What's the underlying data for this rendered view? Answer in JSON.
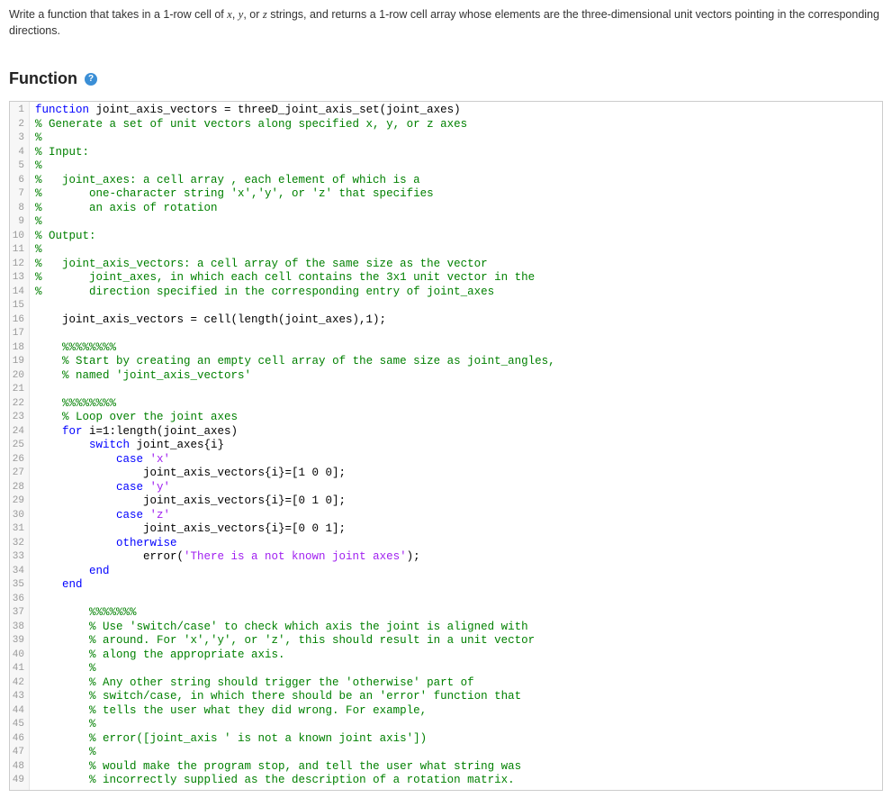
{
  "instruction_parts": {
    "pre": "Write a function that takes in a 1-row cell of ",
    "x": "x",
    "sep1": ", ",
    "y": "y",
    "sep2": ", or ",
    "z": "z",
    "post": " strings, and returns a 1-row cell array whose elements are the three-dimensional unit vectors pointing in the corresponding directions."
  },
  "section_title": "Function",
  "help_glyph": "?",
  "code_lines": [
    [
      [
        "kw",
        "function"
      ],
      [
        "fn",
        " joint_axis_vectors = threeD_joint_axis_set(joint_axes)"
      ]
    ],
    [
      [
        "cm",
        "% Generate a set of unit vectors along specified x, y, or z axes"
      ]
    ],
    [
      [
        "cm",
        "%"
      ]
    ],
    [
      [
        "cm",
        "% Input:"
      ]
    ],
    [
      [
        "cm",
        "%"
      ]
    ],
    [
      [
        "cm",
        "%   joint_axes: a cell array , each element of which is a"
      ]
    ],
    [
      [
        "cm",
        "%       one-character string 'x','y', or 'z' that specifies"
      ]
    ],
    [
      [
        "cm",
        "%       an axis of rotation"
      ]
    ],
    [
      [
        "cm",
        "%"
      ]
    ],
    [
      [
        "cm",
        "% Output:"
      ]
    ],
    [
      [
        "cm",
        "%"
      ]
    ],
    [
      [
        "cm",
        "%   joint_axis_vectors: a cell array of the same size as the vector"
      ]
    ],
    [
      [
        "cm",
        "%       joint_axes, in which each cell contains the 3x1 unit vector in the"
      ]
    ],
    [
      [
        "cm",
        "%       direction specified in the corresponding entry of joint_axes"
      ]
    ],
    [
      [
        "fn",
        ""
      ]
    ],
    [
      [
        "fn",
        "    joint_axis_vectors = cell(length(joint_axes),1);"
      ]
    ],
    [
      [
        "fn",
        ""
      ]
    ],
    [
      [
        "fn",
        "    "
      ],
      [
        "cm",
        "%%%%%%%%"
      ]
    ],
    [
      [
        "fn",
        "    "
      ],
      [
        "cm",
        "% Start by creating an empty cell array of the same size as joint_angles,"
      ]
    ],
    [
      [
        "fn",
        "    "
      ],
      [
        "cm",
        "% named 'joint_axis_vectors'"
      ]
    ],
    [
      [
        "fn",
        ""
      ]
    ],
    [
      [
        "fn",
        "    "
      ],
      [
        "cm",
        "%%%%%%%%"
      ]
    ],
    [
      [
        "fn",
        "    "
      ],
      [
        "cm",
        "% Loop over the joint axes"
      ]
    ],
    [
      [
        "fn",
        "    "
      ],
      [
        "kw",
        "for"
      ],
      [
        "fn",
        " i=1:length(joint_axes)"
      ]
    ],
    [
      [
        "fn",
        "        "
      ],
      [
        "kw",
        "switch"
      ],
      [
        "fn",
        " joint_axes{i}"
      ]
    ],
    [
      [
        "fn",
        "            "
      ],
      [
        "kw",
        "case"
      ],
      [
        "fn",
        " "
      ],
      [
        "str",
        "'x'"
      ]
    ],
    [
      [
        "fn",
        "                joint_axis_vectors{i}=[1 0 0];"
      ]
    ],
    [
      [
        "fn",
        "            "
      ],
      [
        "kw",
        "case"
      ],
      [
        "fn",
        " "
      ],
      [
        "str",
        "'y'"
      ]
    ],
    [
      [
        "fn",
        "                joint_axis_vectors{i}=[0 1 0];"
      ]
    ],
    [
      [
        "fn",
        "            "
      ],
      [
        "kw",
        "case"
      ],
      [
        "fn",
        " "
      ],
      [
        "str",
        "'z'"
      ]
    ],
    [
      [
        "fn",
        "                joint_axis_vectors{i}=[0 0 1];"
      ]
    ],
    [
      [
        "fn",
        "            "
      ],
      [
        "kw",
        "otherwise"
      ]
    ],
    [
      [
        "fn",
        "                error("
      ],
      [
        "str",
        "'There is a not known joint axes'"
      ],
      [
        "fn",
        ");"
      ]
    ],
    [
      [
        "fn",
        "        "
      ],
      [
        "kw",
        "end"
      ]
    ],
    [
      [
        "fn",
        "    "
      ],
      [
        "kw",
        "end"
      ]
    ],
    [
      [
        "fn",
        ""
      ]
    ],
    [
      [
        "fn",
        "        "
      ],
      [
        "cm",
        "%%%%%%%"
      ]
    ],
    [
      [
        "fn",
        "        "
      ],
      [
        "cm",
        "% Use 'switch/case' to check which axis the joint is aligned with"
      ]
    ],
    [
      [
        "fn",
        "        "
      ],
      [
        "cm",
        "% around. For 'x','y', or 'z', this should result in a unit vector"
      ]
    ],
    [
      [
        "fn",
        "        "
      ],
      [
        "cm",
        "% along the appropriate axis."
      ]
    ],
    [
      [
        "fn",
        "        "
      ],
      [
        "cm",
        "%"
      ]
    ],
    [
      [
        "fn",
        "        "
      ],
      [
        "cm",
        "% Any other string should trigger the 'otherwise' part of"
      ]
    ],
    [
      [
        "fn",
        "        "
      ],
      [
        "cm",
        "% switch/case, in which there should be an 'error' function that"
      ]
    ],
    [
      [
        "fn",
        "        "
      ],
      [
        "cm",
        "% tells the user what they did wrong. For example,"
      ]
    ],
    [
      [
        "fn",
        "        "
      ],
      [
        "cm",
        "%"
      ]
    ],
    [
      [
        "fn",
        "        "
      ],
      [
        "cm",
        "% error([joint_axis ' is not a known joint axis'])"
      ]
    ],
    [
      [
        "fn",
        "        "
      ],
      [
        "cm",
        "%"
      ]
    ],
    [
      [
        "fn",
        "        "
      ],
      [
        "cm",
        "% would make the program stop, and tell the user what string was"
      ]
    ],
    [
      [
        "fn",
        "        "
      ],
      [
        "cm",
        "% incorrectly supplied as the description of a rotation matrix."
      ]
    ]
  ]
}
